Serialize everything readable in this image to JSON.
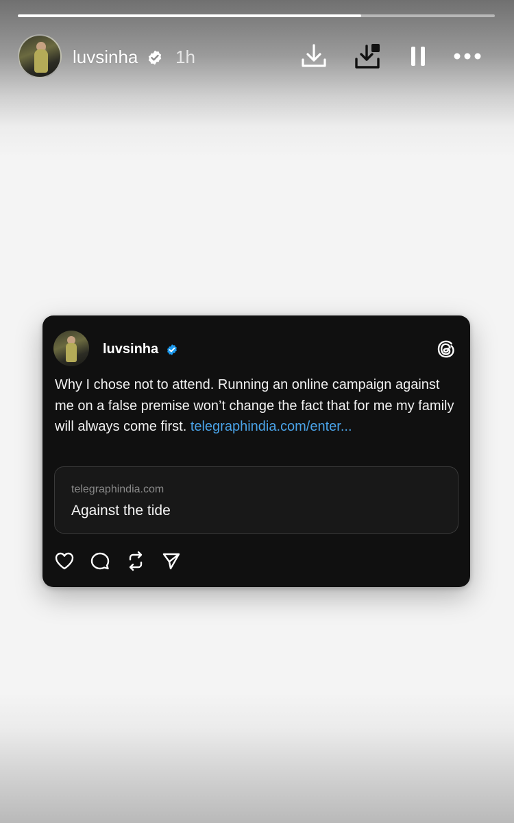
{
  "story": {
    "progress": 0.72,
    "username": "luvsinha",
    "time_ago": "1h",
    "verified": true,
    "header_icons": [
      "download-icon",
      "save-to-device-icon",
      "pause-icon",
      "more-icon"
    ]
  },
  "post": {
    "username": "luvsinha",
    "verified": true,
    "platform_icon": "threads-icon",
    "text": "Why I chose not to attend. Running an online campaign against me on a false premise won’t change the fact that for me my family will always come first. ",
    "link_text": "telegraphindia.com/enter...",
    "link_preview": {
      "domain": "telegraphindia.com",
      "title": "Against the tide"
    },
    "action_icons": [
      "heart-icon",
      "comment-icon",
      "repost-icon",
      "share-icon"
    ]
  },
  "colors": {
    "card_background": "#101010",
    "link": "#4aa3e8",
    "verified_badge": "#1d9bf0"
  }
}
